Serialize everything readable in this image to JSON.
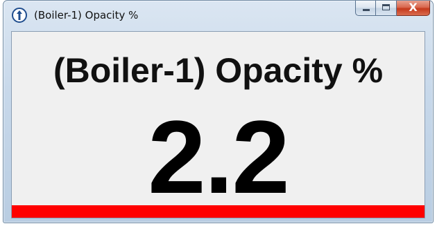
{
  "window": {
    "title": "(Boiler-1) Opacity %",
    "app_icon": "app-logo-icon",
    "controls": {
      "minimize_icon": "minimize-icon",
      "maximize_icon": "maximize-icon",
      "close_icon": "close-icon",
      "close_glyph": "X"
    }
  },
  "display": {
    "heading": "(Boiler-1) Opacity %",
    "value": "2.2",
    "status_color": "#ff0000"
  }
}
